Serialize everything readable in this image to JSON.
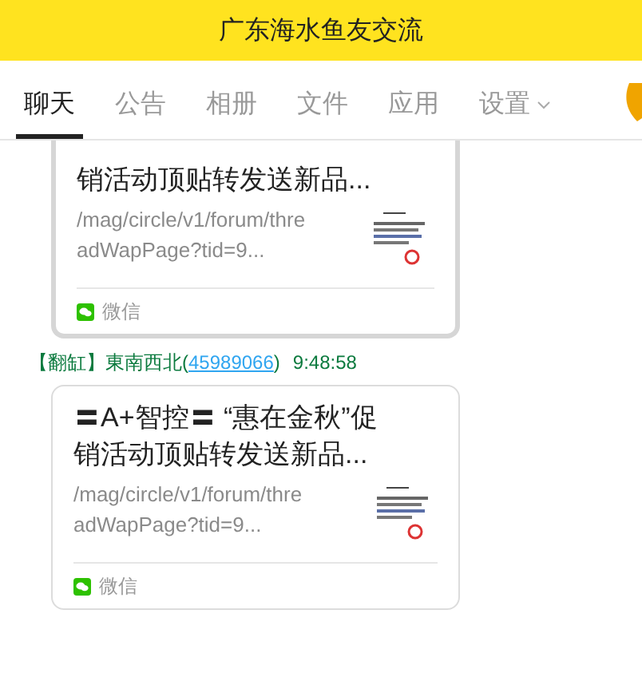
{
  "window": {
    "title": "广东海水鱼友交流"
  },
  "tabs": [
    {
      "label": "聊天",
      "selected": true
    },
    {
      "label": "公告",
      "selected": false
    },
    {
      "label": "相册",
      "selected": false
    },
    {
      "label": "文件",
      "selected": false
    },
    {
      "label": "应用",
      "selected": false
    },
    {
      "label": "设置",
      "selected": false,
      "kind": "dropdown"
    }
  ],
  "messages": [
    {
      "kind": "card",
      "selected": true,
      "title": [
        "销活动顶贴转发送新品..."
      ],
      "url": [
        "/mag/circle/v1/forum/thre",
        "adWapPage?tid=9..."
      ],
      "source": "微信"
    },
    {
      "kind": "sender",
      "tag": "【翻缸】",
      "name": "東南西北",
      "open": "(",
      "qq": "45989066",
      "close": ")",
      "time": "9:48:58"
    },
    {
      "kind": "card",
      "selected": false,
      "title": [
        "〓A+智控〓 “惠在金秋”促",
        "销活动顶贴转发送新品..."
      ],
      "url": [
        "/mag/circle/v1/forum/thre",
        "adWapPage?tid=9..."
      ],
      "source": "微信"
    }
  ]
}
